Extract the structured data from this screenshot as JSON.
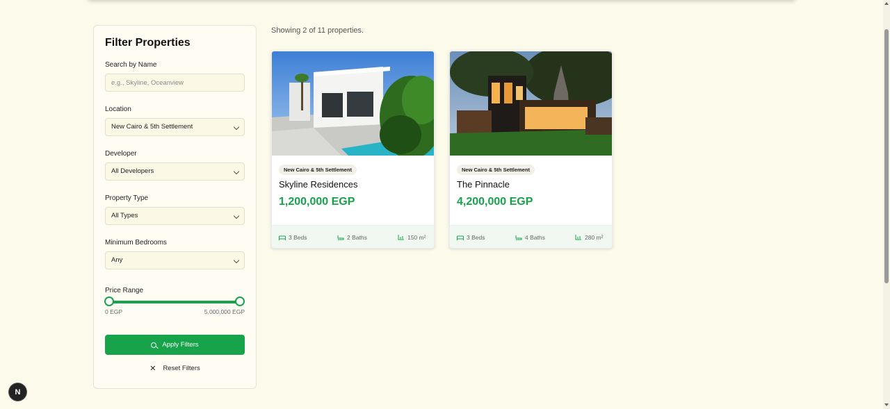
{
  "filters": {
    "title": "Filter Properties",
    "search_label": "Search by Name",
    "search_placeholder": "e.g., Skyline, Oceanview",
    "location_label": "Location",
    "location_value": "New Cairo & 5th Settlement",
    "developer_label": "Developer",
    "developer_value": "All Developers",
    "type_label": "Property Type",
    "type_value": "All Types",
    "bedrooms_label": "Minimum Bedrooms",
    "bedrooms_value": "Any",
    "price_label": "Price Range",
    "price_min": "0 EGP",
    "price_max": "5,000,000 EGP",
    "apply_label": "Apply Filters",
    "reset_label": "Reset Filters"
  },
  "results": {
    "showing_text": "Showing 2 of 11 properties."
  },
  "properties": [
    {
      "location": "New Cairo & 5th Settlement",
      "name": "Skyline Residences",
      "price": "1,200,000 EGP",
      "beds": "3 Beds",
      "baths": "2 Baths",
      "area": "150 m²"
    },
    {
      "location": "New Cairo & 5th Settlement",
      "name": "The Pinnacle",
      "price": "4,200,000 EGP",
      "beds": "3 Beds",
      "baths": "4 Baths",
      "area": "280 m²"
    }
  ],
  "badge": {
    "letter": "N"
  },
  "colors": {
    "accent": "#16a34a",
    "background": "#fcfaeb"
  }
}
